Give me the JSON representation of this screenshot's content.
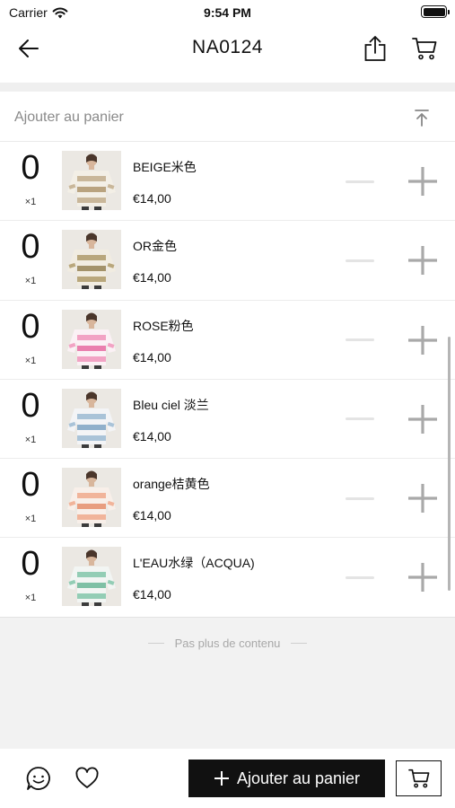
{
  "status_bar": {
    "carrier": "Carrier",
    "time": "9:54 PM"
  },
  "nav": {
    "title": "NA0124"
  },
  "section": {
    "label": "Ajouter au panier"
  },
  "items": [
    {
      "qty": "0",
      "mult": "×1",
      "name": "BEIGE米色",
      "price": "€14,00",
      "colors": [
        "#c9b79a",
        "#f3efe6",
        "#b9a37f"
      ]
    },
    {
      "qty": "0",
      "mult": "×1",
      "name": "OR金色",
      "price": "€14,00",
      "colors": [
        "#b9a77c",
        "#f1ece1",
        "#a3926a"
      ]
    },
    {
      "qty": "0",
      "mult": "×1",
      "name": "ROSE粉色",
      "price": "€14,00",
      "colors": [
        "#f2a3c4",
        "#fbf1f5",
        "#ea7fae"
      ]
    },
    {
      "qty": "0",
      "mult": "×1",
      "name": "Bleu ciel 淡兰",
      "price": "€14,00",
      "colors": [
        "#a9c3d8",
        "#f3f4f6",
        "#90b0cb"
      ]
    },
    {
      "qty": "0",
      "mult": "×1",
      "name": "orange桔黄色",
      "price": "€14,00",
      "colors": [
        "#f1b49a",
        "#f8efe9",
        "#e89d7f"
      ]
    },
    {
      "qty": "0",
      "mult": "×1",
      "name": "L'EAU水绿（ACQUA)",
      "price": "€14,00",
      "colors": [
        "#93cdb5",
        "#f2f5f3",
        "#7ec0a5"
      ]
    }
  ],
  "footer": {
    "end_note": "Pas plus de contenu"
  },
  "bottom": {
    "add_label": "Ajouter au panier"
  },
  "icons": [
    "back-arrow-icon",
    "share-icon",
    "cart-icon",
    "collapse-top-icon",
    "minus-icon",
    "plus-icon",
    "chat-icon",
    "heart-icon",
    "wifi-icon"
  ]
}
